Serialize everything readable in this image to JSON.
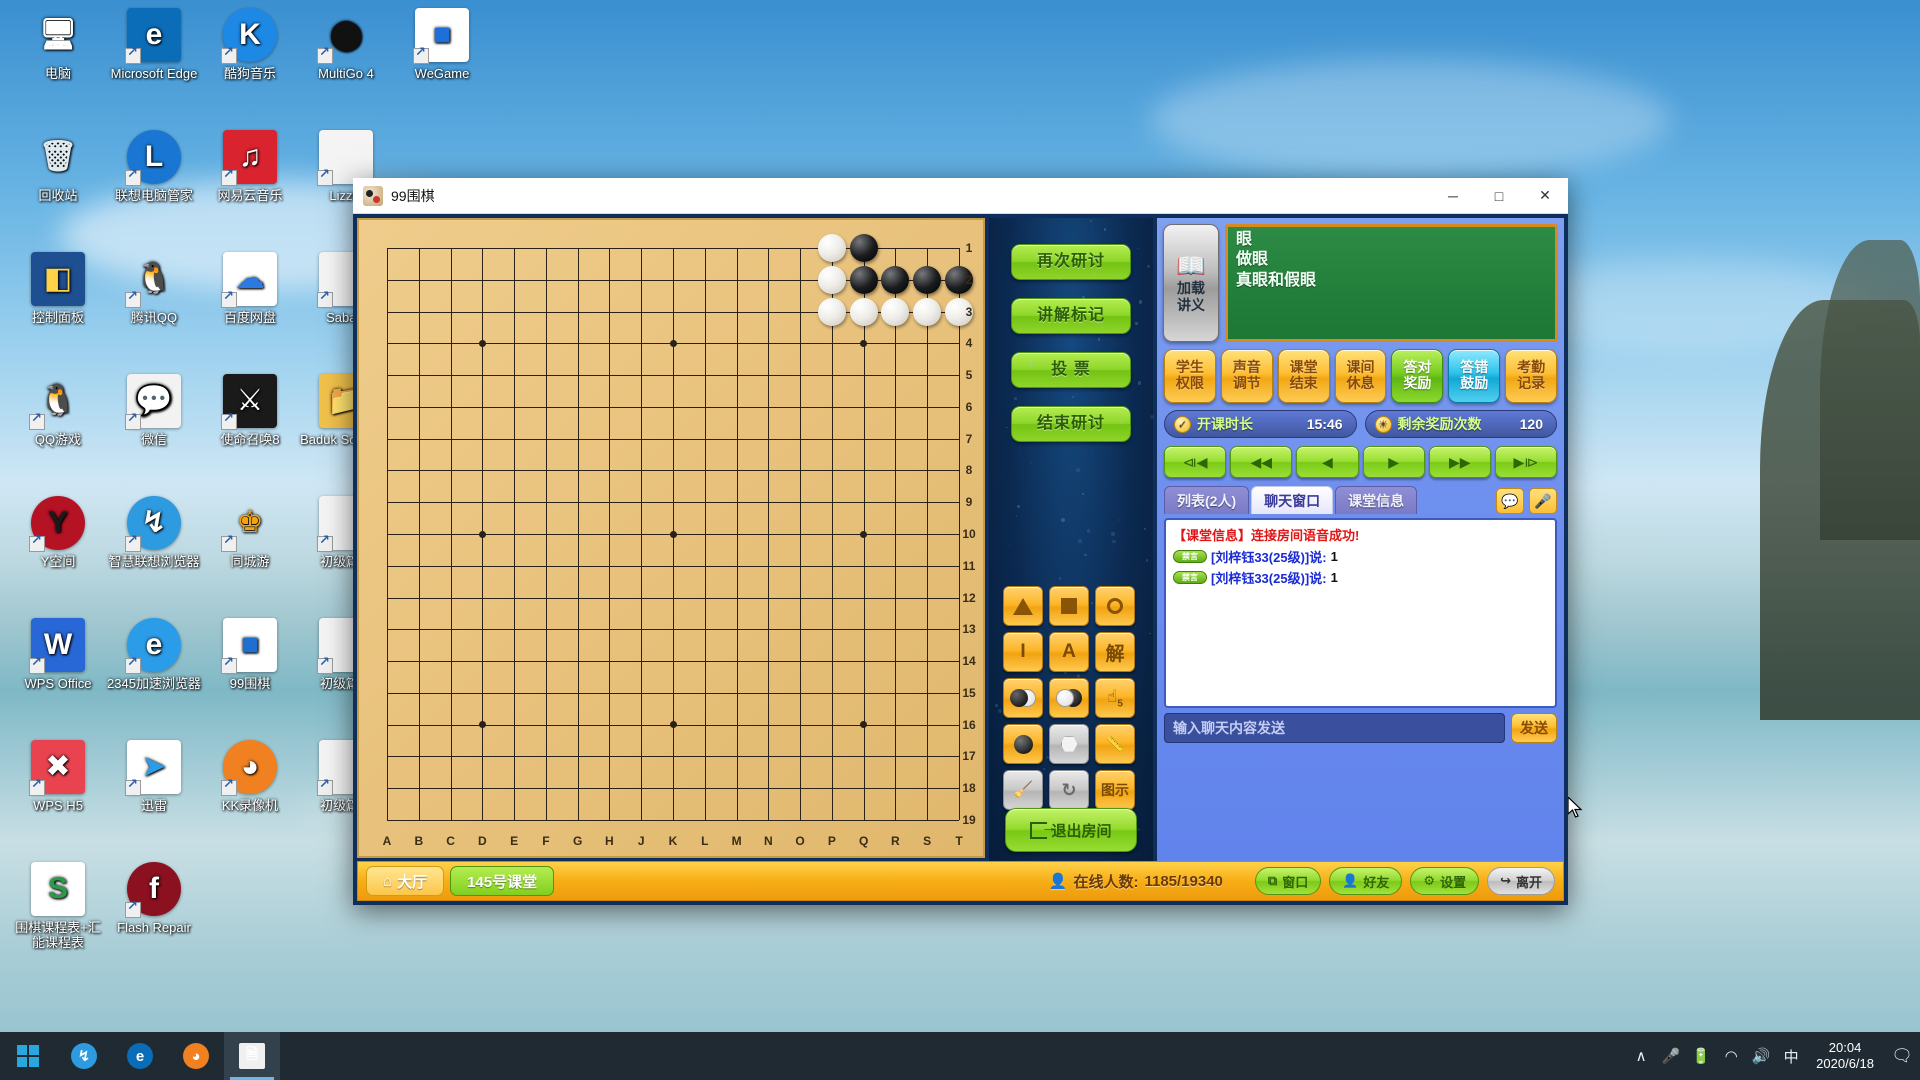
{
  "desktop": {
    "icons": [
      {
        "label": "电脑",
        "icon": "computer-icon",
        "col": 0,
        "row": 0,
        "shortcut": false
      },
      {
        "label": "Microsoft Edge",
        "icon": "edge-icon",
        "col": 1,
        "row": 0,
        "shortcut": true
      },
      {
        "label": "酷狗音乐",
        "icon": "kugou-icon",
        "col": 2,
        "row": 0,
        "shortcut": true
      },
      {
        "label": "MultiGo 4",
        "icon": "multigo-icon",
        "col": 3,
        "row": 0,
        "shortcut": true
      },
      {
        "label": "WeGame",
        "icon": "wegame-icon",
        "col": 4,
        "row": 0,
        "shortcut": true
      },
      {
        "label": "回收站",
        "icon": "recycle-bin-icon",
        "col": 0,
        "row": 1,
        "shortcut": false
      },
      {
        "label": "联想电脑管家",
        "icon": "lenovo-manager-icon",
        "col": 1,
        "row": 1,
        "shortcut": true
      },
      {
        "label": "网易云音乐",
        "icon": "netease-music-icon",
        "col": 2,
        "row": 1,
        "shortcut": true
      },
      {
        "label": "Lizzie",
        "icon": "file-icon",
        "col": 3,
        "row": 1,
        "shortcut": true
      },
      {
        "label": "控制面板",
        "icon": "control-panel-icon",
        "col": 0,
        "row": 2,
        "shortcut": false
      },
      {
        "label": "腾讯QQ",
        "icon": "qq-icon",
        "col": 1,
        "row": 2,
        "shortcut": true
      },
      {
        "label": "百度网盘",
        "icon": "baidu-netdisk-icon",
        "col": 2,
        "row": 2,
        "shortcut": true
      },
      {
        "label": "Sabaki",
        "icon": "file-icon",
        "col": 3,
        "row": 2,
        "shortcut": true
      },
      {
        "label": "QQ游戏",
        "icon": "qq-games-icon",
        "col": 0,
        "row": 3,
        "shortcut": true
      },
      {
        "label": "微信",
        "icon": "wechat-icon",
        "col": 1,
        "row": 3,
        "shortcut": true
      },
      {
        "label": "使命召唤8",
        "icon": "call-of-duty-icon",
        "col": 2,
        "row": 3,
        "shortcut": true
      },
      {
        "label": "Baduk Software",
        "icon": "folder-icon",
        "col": 3,
        "row": 3,
        "shortcut": false
      },
      {
        "label": "Y空间",
        "icon": "y-space-icon",
        "col": 0,
        "row": 4,
        "shortcut": true
      },
      {
        "label": "智慧联想浏览器",
        "icon": "lenovo-browser-icon",
        "col": 1,
        "row": 4,
        "shortcut": true
      },
      {
        "label": "同城游",
        "icon": "tongchengyou-icon",
        "col": 2,
        "row": 4,
        "shortcut": true
      },
      {
        "label": "初级篇上",
        "icon": "file-icon",
        "col": 3,
        "row": 4,
        "shortcut": true
      },
      {
        "label": "WPS Office",
        "icon": "wps-office-icon",
        "col": 0,
        "row": 5,
        "shortcut": true
      },
      {
        "label": "2345加速浏览器",
        "icon": "browser-2345-icon",
        "col": 1,
        "row": 5,
        "shortcut": true
      },
      {
        "label": "99围棋",
        "icon": "99weiqi-icon",
        "col": 2,
        "row": 5,
        "shortcut": true
      },
      {
        "label": "初级篇中",
        "icon": "file-icon",
        "col": 3,
        "row": 5,
        "shortcut": true
      },
      {
        "label": "WPS H5",
        "icon": "wps-h5-icon",
        "col": 0,
        "row": 6,
        "shortcut": true
      },
      {
        "label": "迅雷",
        "icon": "thunder-icon",
        "col": 1,
        "row": 6,
        "shortcut": true
      },
      {
        "label": "KK录像机",
        "icon": "kk-recorder-icon",
        "col": 2,
        "row": 6,
        "shortcut": true
      },
      {
        "label": "初级篇下",
        "icon": "file-icon",
        "col": 3,
        "row": 6,
        "shortcut": true
      },
      {
        "label": "围棋课程表+汇能课程表",
        "icon": "spreadsheet-icon",
        "col": 0,
        "row": 7,
        "shortcut": false
      },
      {
        "label": "Flash Repair",
        "icon": "flash-repair-icon",
        "col": 1,
        "row": 7,
        "shortcut": true
      }
    ]
  },
  "taskbar": {
    "start_label": "start",
    "items": [
      {
        "name": "taskbar-lenovo-browser",
        "icon": "lenovo-browser-icon"
      },
      {
        "name": "taskbar-edge",
        "icon": "edge-icon"
      },
      {
        "name": "taskbar-kk-recorder",
        "icon": "kk-recorder-icon"
      },
      {
        "name": "taskbar-99weiqi",
        "icon": "document-icon",
        "active": true
      }
    ],
    "tray": [
      "chevron-up-icon",
      "microphone-icon",
      "battery-icon",
      "wifi-icon",
      "volume-icon"
    ],
    "ime": "中",
    "time": "20:04",
    "date": "2020/6/18"
  },
  "window": {
    "title": "99围棋",
    "minimize": "─",
    "maximize": "□",
    "close": "✕"
  },
  "board": {
    "size": 19,
    "col_labels": [
      "A",
      "B",
      "C",
      "D",
      "E",
      "F",
      "G",
      "H",
      "J",
      "K",
      "L",
      "M",
      "N",
      "O",
      "P",
      "Q",
      "R",
      "S",
      "T"
    ],
    "row_labels": [
      "1",
      "2",
      "3",
      "4",
      "5",
      "6",
      "7",
      "8",
      "9",
      "10",
      "11",
      "12",
      "13",
      "14",
      "15",
      "16",
      "17",
      "18",
      "19"
    ],
    "stones": [
      {
        "col": 14,
        "row": 1,
        "color": "w"
      },
      {
        "col": 15,
        "row": 1,
        "color": "b"
      },
      {
        "col": 14,
        "row": 2,
        "color": "w"
      },
      {
        "col": 15,
        "row": 2,
        "color": "b"
      },
      {
        "col": 16,
        "row": 2,
        "color": "b"
      },
      {
        "col": 17,
        "row": 2,
        "color": "b"
      },
      {
        "col": 18,
        "row": 2,
        "color": "b"
      },
      {
        "col": 14,
        "row": 3,
        "color": "w"
      },
      {
        "col": 15,
        "row": 3,
        "color": "w"
      },
      {
        "col": 16,
        "row": 3,
        "color": "w"
      },
      {
        "col": 17,
        "row": 3,
        "color": "w"
      },
      {
        "col": 18,
        "row": 3,
        "color": "w"
      }
    ]
  },
  "mid_panel": {
    "buttons": [
      {
        "name": "restudy-button",
        "label": "再次研讨"
      },
      {
        "name": "explain-mark-button",
        "label": "讲解标记"
      },
      {
        "name": "vote-button",
        "label": "投 票"
      },
      {
        "name": "end-study-button",
        "label": "结束研讨"
      }
    ],
    "tools": [
      {
        "name": "tool-triangle",
        "glyph": "triangle",
        "disabled": false
      },
      {
        "name": "tool-square",
        "glyph": "square",
        "disabled": false
      },
      {
        "name": "tool-circle",
        "glyph": "circle",
        "disabled": false
      },
      {
        "name": "tool-line",
        "glyph": "I",
        "disabled": false
      },
      {
        "name": "tool-letter",
        "glyph": "A",
        "disabled": false
      },
      {
        "name": "tool-answer",
        "glyph": "解",
        "disabled": false
      },
      {
        "name": "tool-black-white-order",
        "glyph": "bw",
        "disabled": false
      },
      {
        "name": "tool-white-black-order",
        "glyph": "wb",
        "disabled": false
      },
      {
        "name": "tool-hand-number",
        "glyph": "hand5",
        "disabled": false
      },
      {
        "name": "tool-black-stone",
        "glyph": "black",
        "disabled": false
      },
      {
        "name": "tool-white-stone",
        "glyph": "hexwhite",
        "disabled": true
      },
      {
        "name": "tool-ruler",
        "glyph": "ruler",
        "disabled": false
      },
      {
        "name": "tool-eraser",
        "glyph": "brush",
        "disabled": true
      },
      {
        "name": "tool-refresh",
        "glyph": "refresh",
        "disabled": true
      },
      {
        "name": "tool-legend",
        "glyph": "图示",
        "disabled": false
      }
    ],
    "exit_room_label": "退出房间"
  },
  "right_panel": {
    "load_lecture_label_1": "加载",
    "load_lecture_label_2": "讲义",
    "blackboard_lines": [
      "眼",
      "做眼",
      "真眼和假眼"
    ],
    "control_buttons": [
      {
        "name": "student-permission-button",
        "l1": "学生",
        "l2": "权限",
        "style": "yellow"
      },
      {
        "name": "sound-adjust-button",
        "l1": "声音",
        "l2": "调节",
        "style": "yellow"
      },
      {
        "name": "class-end-button",
        "l1": "课堂",
        "l2": "结束",
        "style": "yellow"
      },
      {
        "name": "class-break-button",
        "l1": "课间",
        "l2": "休息",
        "style": "yellow"
      },
      {
        "name": "correct-reward-button",
        "l1": "答对",
        "l2": "奖励",
        "style": "green"
      },
      {
        "name": "wrong-encourage-button",
        "l1": "答错",
        "l2": "鼓励",
        "style": "cyan"
      },
      {
        "name": "attendance-record-button",
        "l1": "考勤",
        "l2": "记录",
        "style": "yellow"
      }
    ],
    "status": [
      {
        "name": "class-duration-status",
        "icon": "clock-icon",
        "label": "开课时长",
        "value": "15:46"
      },
      {
        "name": "remaining-rewards-status",
        "icon": "coin-icon",
        "label": "剩余奖励次数",
        "value": "120"
      }
    ],
    "nav_buttons": [
      {
        "name": "nav-first-button",
        "glyph": "⧏◀"
      },
      {
        "name": "nav-fast-back-button",
        "glyph": "◀◀"
      },
      {
        "name": "nav-back-button",
        "glyph": "◀"
      },
      {
        "name": "nav-forward-button",
        "glyph": "▶"
      },
      {
        "name": "nav-fast-forward-button",
        "glyph": "▶▶"
      },
      {
        "name": "nav-last-button",
        "glyph": "▶⧐"
      }
    ],
    "tabs": [
      {
        "name": "tab-list",
        "label": "列表(2人)",
        "active": false
      },
      {
        "name": "tab-chat",
        "label": "聊天窗口",
        "active": true
      },
      {
        "name": "tab-class-info",
        "label": "课堂信息",
        "active": false
      }
    ],
    "tab_icons": [
      {
        "name": "chat-bubble-icon",
        "glyph": "ὊC"
      },
      {
        "name": "microphone-icon",
        "glyph": "Ἲ4"
      }
    ],
    "chat": {
      "system_message": "【课堂信息】连接房间语音成功!",
      "messages": [
        {
          "badge": "禁言",
          "user": "[刘梓钰33(25级)]说:",
          "text": "1"
        },
        {
          "badge": "禁言",
          "user": "[刘梓钰33(25级)]说:",
          "text": "1"
        }
      ],
      "input_placeholder": "输入聊天内容发送",
      "input_value": "",
      "send_label": "发送"
    }
  },
  "bottom_bar": {
    "tabs": [
      {
        "name": "lobby-tab",
        "label": "大厅",
        "icon": "home-icon",
        "active": false
      },
      {
        "name": "classroom-tab",
        "label": "145号课堂",
        "icon": "",
        "active": true
      }
    ],
    "online_label": "在线人数:",
    "online_value": "1185/19340",
    "actions": [
      {
        "name": "window-button",
        "label": "窗口",
        "icon": "window-icon",
        "style": "green"
      },
      {
        "name": "friends-button",
        "label": "好友",
        "icon": "person-icon",
        "style": "green"
      },
      {
        "name": "settings-button",
        "label": "设置",
        "icon": "gear-icon",
        "style": "green"
      },
      {
        "name": "leave-button",
        "label": "离开",
        "icon": "exit-icon",
        "style": "grey"
      }
    ]
  }
}
